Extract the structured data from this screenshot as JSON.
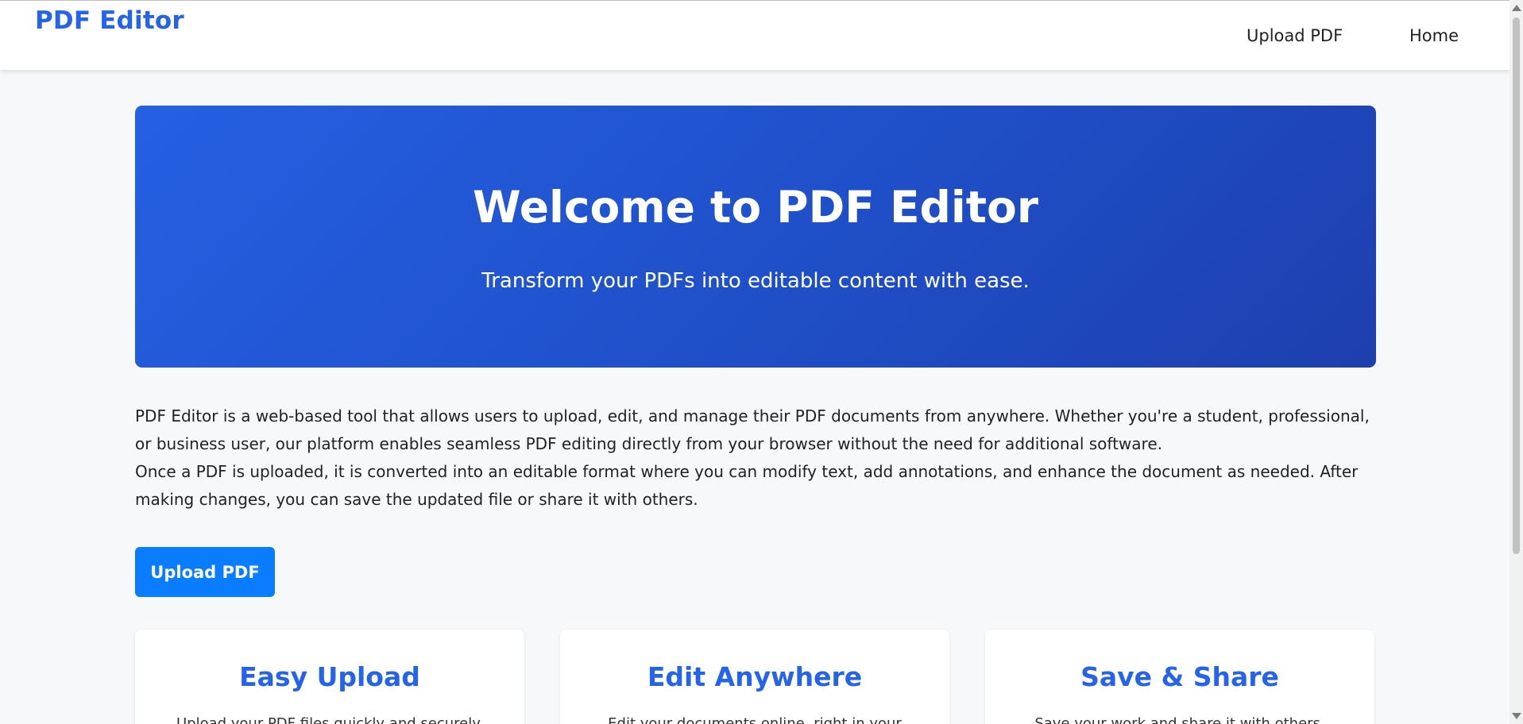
{
  "navbar": {
    "brand": "PDF Editor",
    "links": [
      "Upload PDF",
      "Home"
    ]
  },
  "hero": {
    "title": "Welcome to PDF Editor",
    "subtitle": "Transform your PDFs into editable content with ease."
  },
  "description": {
    "paragraphs": [
      "PDF Editor is a web-based tool that allows users to upload, edit, and manage their PDF documents from anywhere. Whether you're a student, professional, or business user, our platform enables seamless PDF editing directly from your browser without the need for additional software.",
      "Once a PDF is uploaded, it is converted into an editable format where you can modify text, add annotations, and enhance the document as needed. After making changes, you can save the updated file or share it with others."
    ]
  },
  "cta": {
    "upload_label": "Upload PDF"
  },
  "features": [
    {
      "title": "Easy Upload",
      "text": "Upload your PDF files quickly and securely."
    },
    {
      "title": "Edit Anywhere",
      "text": "Edit your documents online, right in your browser."
    },
    {
      "title": "Save & Share",
      "text": "Save your work and share it with others."
    }
  ],
  "colors": {
    "brand": "#2563eb",
    "button": "#0a7cff",
    "hero_start": "#2560e3",
    "hero_end": "#1e3fae",
    "background": "#f7f8fa"
  }
}
